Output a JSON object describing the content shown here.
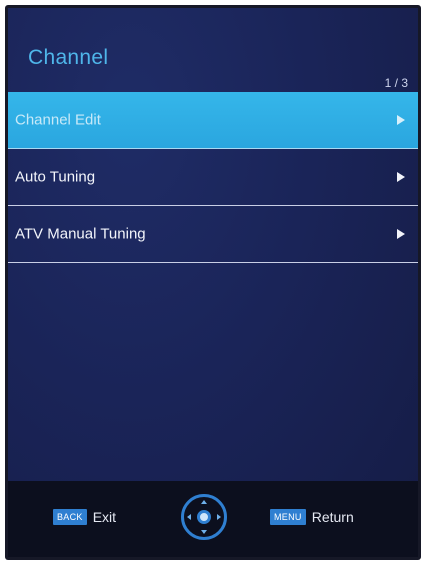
{
  "header": {
    "title": "Channel",
    "page_indicator": "1 / 3"
  },
  "menu": {
    "items": [
      {
        "label": "Channel Edit",
        "selected": true,
        "icon": "arrow-right-icon"
      },
      {
        "label": "Auto Tuning",
        "selected": false,
        "icon": "arrow-right-icon"
      },
      {
        "label": "ATV Manual Tuning",
        "selected": false,
        "icon": "arrow-right-icon"
      }
    ]
  },
  "footer": {
    "back_key": "BACK",
    "back_label": "Exit",
    "nav_icon": "dpad-icon",
    "menu_key": "MENU",
    "menu_label": "Return"
  },
  "colors": {
    "background": "#1a2458",
    "title": "#4fb6ea",
    "selected_row": "#2fb0e6",
    "key_badge": "#2f7fd1",
    "footer": "#0c0f1e"
  }
}
